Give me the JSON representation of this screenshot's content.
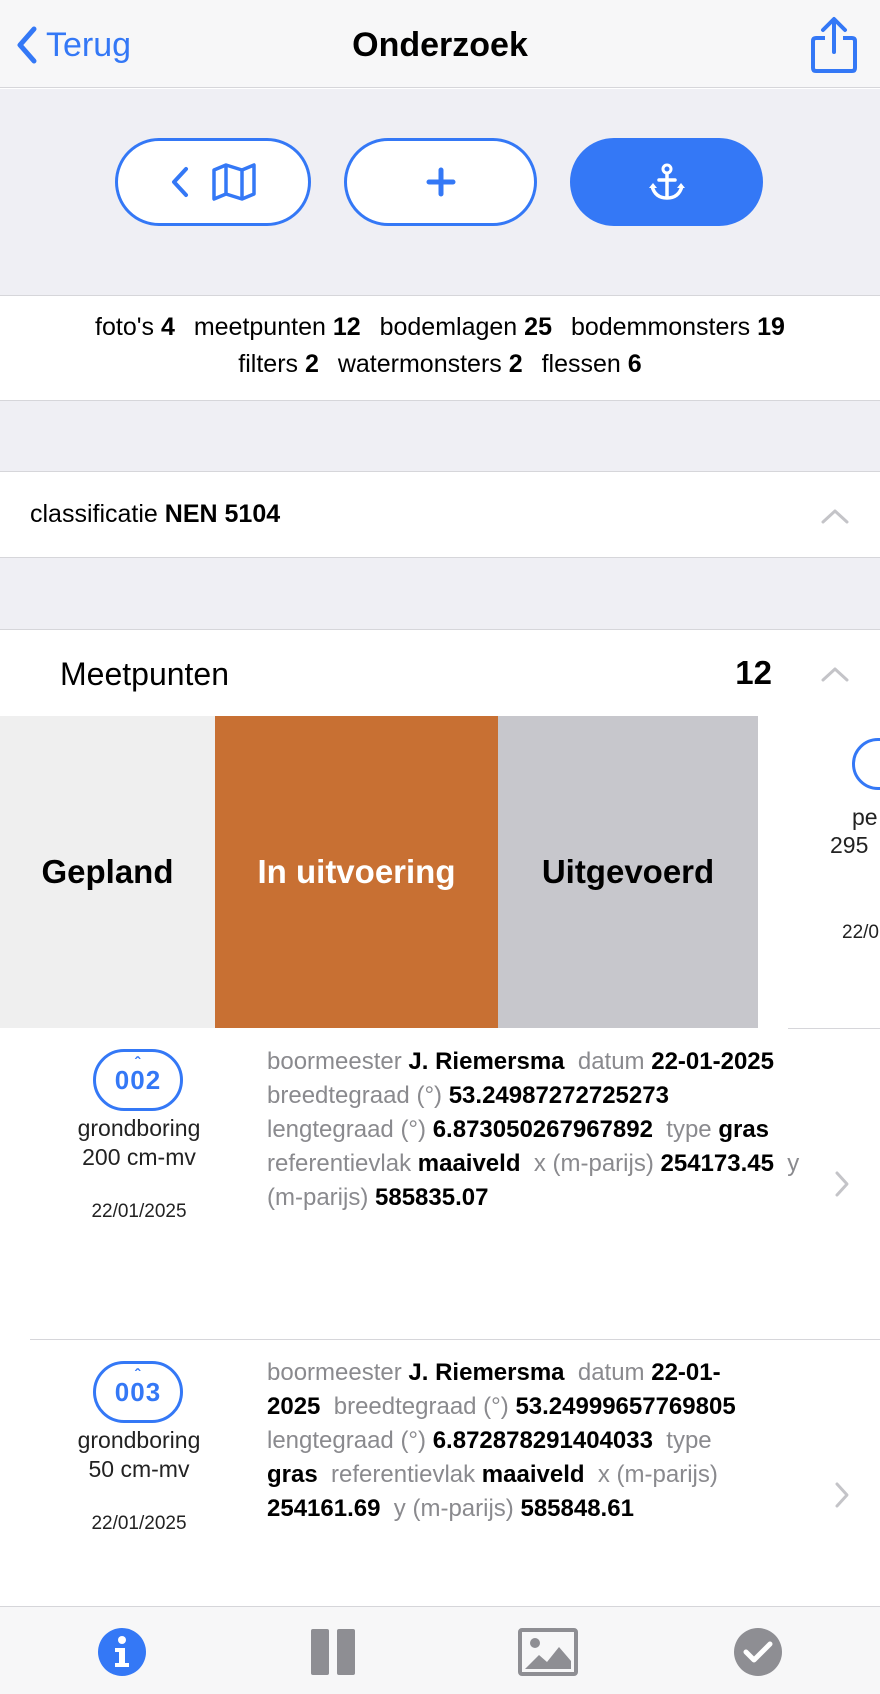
{
  "nav": {
    "back_label": "Terug",
    "title": "Onderzoek",
    "back_icon": "chevron-left-icon",
    "share_icon": "share-icon"
  },
  "toolbar": {
    "map_button_icons": [
      "chevron-left-icon",
      "map-icon"
    ],
    "add_button_icon": "plus-icon",
    "anchor_button_icon": "anchor-icon",
    "accent_color": "#3478f6"
  },
  "counts": {
    "line1": [
      {
        "label": "foto's",
        "value": "4"
      },
      {
        "label": "meetpunten",
        "value": "12"
      },
      {
        "label": "bodemlagen",
        "value": "25"
      },
      {
        "label": "bodemmonsters",
        "value": "19"
      }
    ],
    "line2": [
      {
        "label": "filters",
        "value": "2"
      },
      {
        "label": "watermonsters",
        "value": "2"
      },
      {
        "label": "flessen",
        "value": "6"
      }
    ]
  },
  "classification": {
    "label": "classificatie",
    "value": "NEN 5104",
    "icon": "chevron-up-icon"
  },
  "meetpunten": {
    "title": "Meetpunten",
    "count": "12",
    "icon": "chevron-up-icon",
    "status_actions": [
      {
        "label": "Gepland",
        "color": "#efefef",
        "text_color": "#000000"
      },
      {
        "label": "In uitvoering",
        "color": "#c87033",
        "text_color": "#ffffff"
      },
      {
        "label": "Uitgevoerd",
        "color": "#c7c7cc",
        "text_color": "#000000"
      }
    ],
    "peek": {
      "text1": "pe",
      "text2": "295",
      "text3": "22/0"
    },
    "items": [
      {
        "id": "002",
        "type": "grondboring",
        "depth": "200 cm-mv",
        "date": "22/01/2025",
        "details": [
          {
            "k": "boormeester",
            "v": "J. Riemersma"
          },
          {
            "k": "datum",
            "v": "22-01-2025"
          },
          {
            "k": "breedtegraad (°)",
            "v": "53.24987272725273"
          },
          {
            "k": "lengtegraad (°)",
            "v": "6.873050267967892"
          },
          {
            "k": "type",
            "v": "gras"
          },
          {
            "k": "referentievlak",
            "v": "maaiveld"
          },
          {
            "k": "x (m-parijs)",
            "v": "254173.45"
          },
          {
            "k": "y (m-parijs)",
            "v": "585835.07"
          }
        ]
      },
      {
        "id": "003",
        "type": "grondboring",
        "depth": "50 cm-mv",
        "date": "22/01/2025",
        "details": [
          {
            "k": "boormeester",
            "v": "J. Riemersma"
          },
          {
            "k": "datum",
            "v": "22-01-2025"
          },
          {
            "k": "breedtegraad (°)",
            "v": "53.24999657769805"
          },
          {
            "k": "lengtegraad (°)",
            "v": "6.872878291404033"
          },
          {
            "k": "type",
            "v": "gras"
          },
          {
            "k": "referentievlak",
            "v": "maaiveld"
          },
          {
            "k": "x (m-parijs)",
            "v": "254161.69"
          },
          {
            "k": "y (m-parijs)",
            "v": "585848.61"
          }
        ]
      }
    ]
  },
  "tabbar": {
    "tabs": [
      "info-icon",
      "columns-icon",
      "photo-icon",
      "checkmark-icon"
    ],
    "active_tab": "info-icon"
  }
}
